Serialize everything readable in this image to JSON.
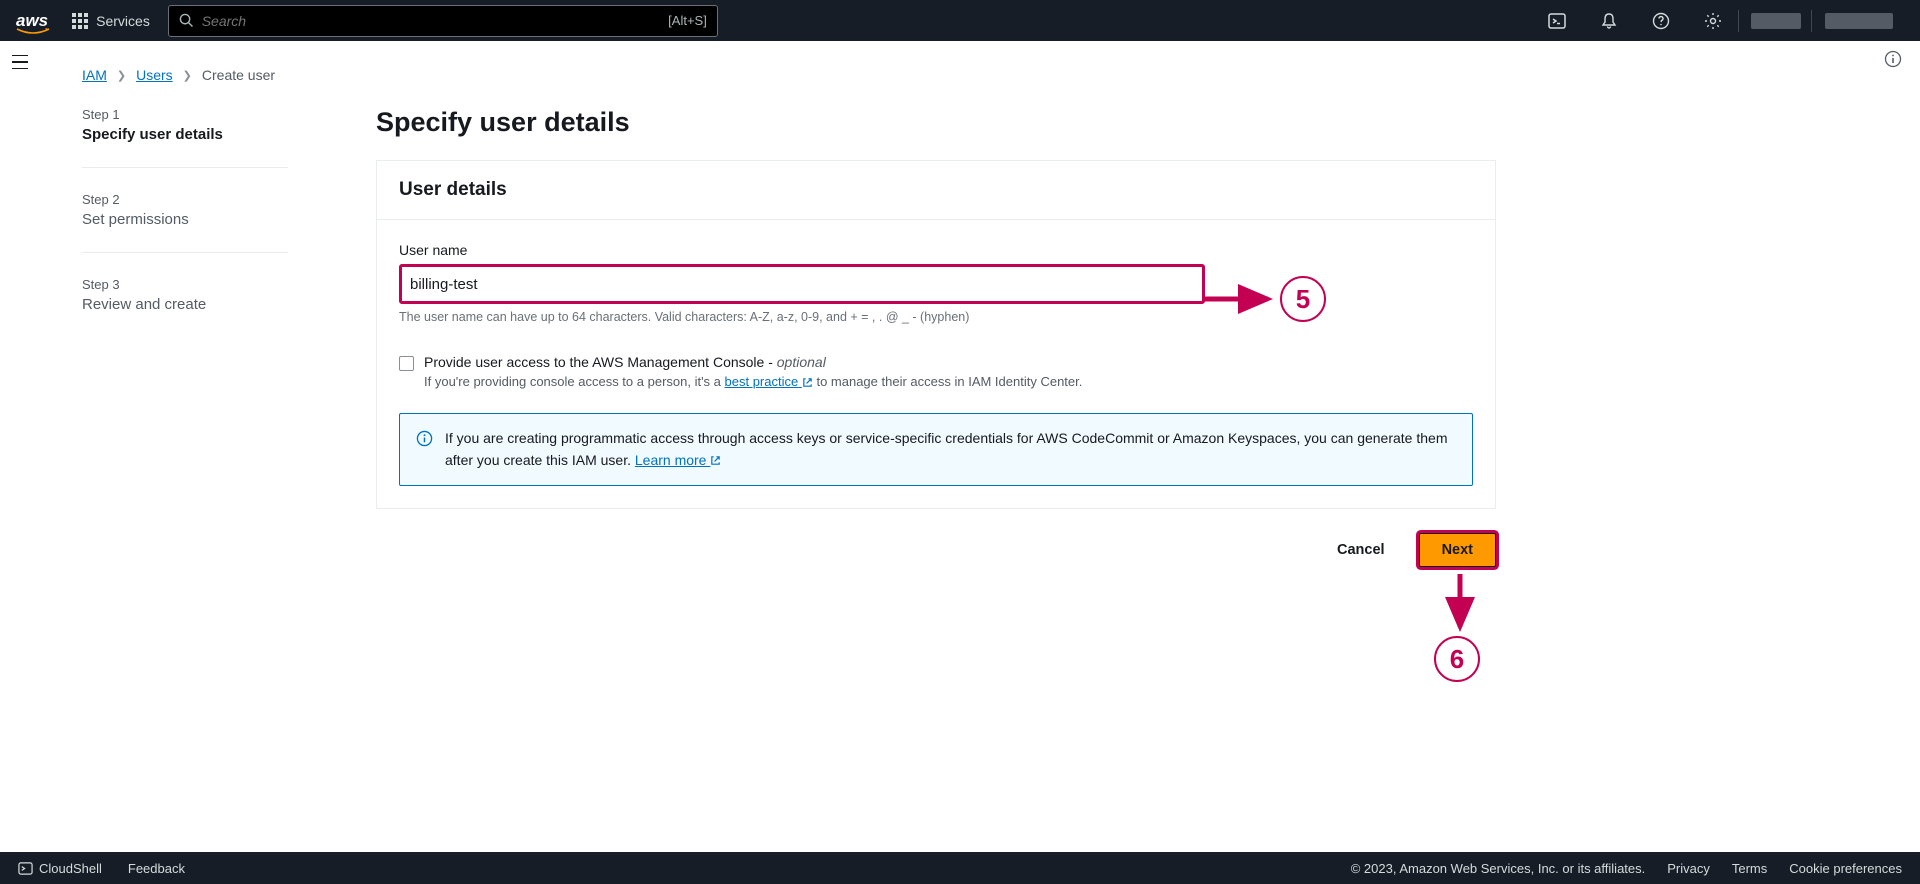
{
  "header": {
    "logo_text": "aws",
    "services_label": "Services",
    "search_placeholder": "Search",
    "search_shortcut": "[Alt+S]"
  },
  "breadcrumb": {
    "item1": "IAM",
    "item2": "Users",
    "item3": "Create user"
  },
  "steps": {
    "s1_num": "Step 1",
    "s1_label": "Specify user details",
    "s2_num": "Step 2",
    "s2_label": "Set permissions",
    "s3_num": "Step 3",
    "s3_label": "Review and create"
  },
  "page": {
    "title": "Specify user details",
    "panel_title": "User details",
    "username_label": "User name",
    "username_value": "billing-test",
    "username_hint": "The user name can have up to 64 characters. Valid characters: A-Z, a-z, 0-9, and + = , . @ _ - (hyphen)",
    "checkbox_main": "Provide user access to the AWS Management Console - ",
    "checkbox_optional": "optional",
    "checkbox_sub_pre": "If you're providing console access to a person, it's a ",
    "checkbox_sub_link": "best practice",
    "checkbox_sub_post": " to manage their access in IAM Identity Center.",
    "info_text_pre": "If you are creating programmatic access through access keys or service-specific credentials for AWS CodeCommit or Amazon Keyspaces, you can generate them after you create this IAM user. ",
    "info_link": "Learn more"
  },
  "buttons": {
    "cancel": "Cancel",
    "next": "Next"
  },
  "footer": {
    "cloudshell": "CloudShell",
    "feedback": "Feedback",
    "copyright": "© 2023, Amazon Web Services, Inc. or its affiliates.",
    "privacy": "Privacy",
    "terms": "Terms",
    "cookie": "Cookie preferences"
  },
  "annotations": {
    "n5": "5",
    "n6": "6"
  }
}
